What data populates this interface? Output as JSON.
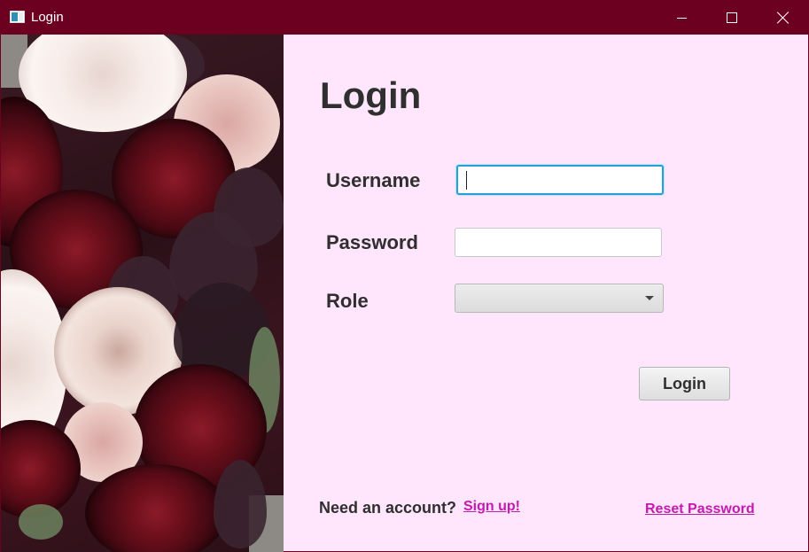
{
  "window": {
    "title": "Login",
    "controls": {
      "minimize": "minimize",
      "maximize": "maximize",
      "close": "close"
    }
  },
  "colors": {
    "titlebar": "#6b0021",
    "background": "#ffe6fd",
    "link": "#c51ab0",
    "focus": "#2a9fd6"
  },
  "form": {
    "heading": "Login",
    "username_label": "Username",
    "username_value": "",
    "password_label": "Password",
    "password_value": "",
    "role_label": "Role",
    "role_value": "",
    "login_button": "Login"
  },
  "footer": {
    "need_account": "Need an account?",
    "signup_link": "Sign up!",
    "reset_link": "Reset Password"
  }
}
